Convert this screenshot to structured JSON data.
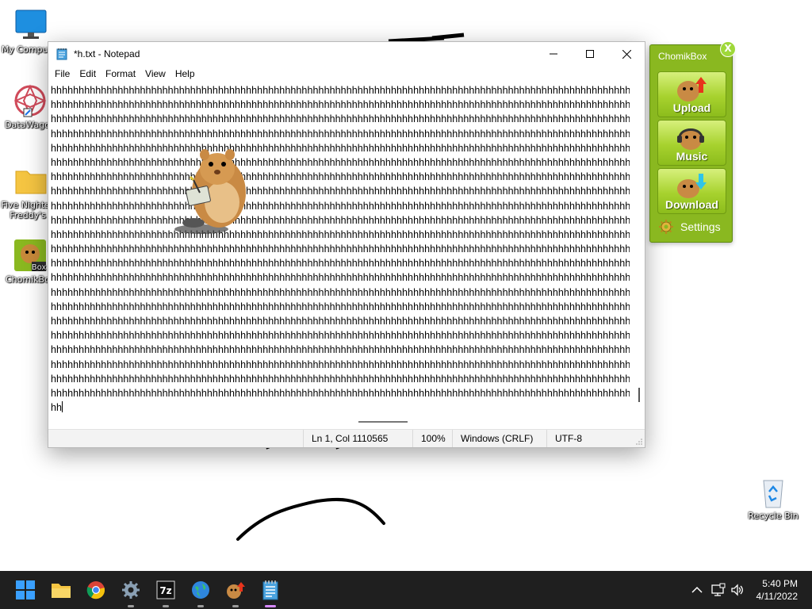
{
  "desktop": {
    "icons": [
      {
        "label": "My Computer",
        "icon": "monitor-icon"
      },
      {
        "label": "DataWagon",
        "icon": "datawagon-icon"
      },
      {
        "label": "Five Nights at",
        "label2": "Freddy's (",
        "icon": "folder-icon"
      },
      {
        "label": "ChomikBox",
        "icon": "chomikbox-icon"
      },
      {
        "label": "Recycle Bin",
        "icon": "recycle-bin-icon"
      }
    ]
  },
  "notepad": {
    "title": "*h.txt - Notepad",
    "menu": [
      "File",
      "Edit",
      "Format",
      "View",
      "Help"
    ],
    "line_text": "hhhhhhhhhhhhhhhhhhhhhhhhhhhhhhhhhhhhhhhhhhhhhhhhhhhhhhhhhhhhhhhhhhhhhhhhhhhhhhhhhhhhhhhhhhhhhhhhhhhhhhhhhhhhhhhhhhhhhhhhhhhhhhhhhhhhhhhhhhhhhhhhhhhhhhhhhhhhhh",
    "full_lines": 22,
    "last_line": "hh",
    "status": {
      "position": "Ln 1, Col 1110565",
      "zoom": "100%",
      "line_ending": "Windows (CRLF)",
      "encoding": "UTF-8"
    }
  },
  "chomikbox": {
    "title": "ChomikBox",
    "close": "X",
    "buttons": [
      {
        "label": "Upload",
        "icon": "upload-arrow-icon"
      },
      {
        "label": "Music",
        "icon": "headphones-icon"
      },
      {
        "label": "Download",
        "icon": "download-arrow-icon"
      }
    ],
    "settings_label": "Settings"
  },
  "taskbar": {
    "apps": [
      "start",
      "file-explorer",
      "chrome",
      "settings",
      "7zip",
      "network-globe",
      "chomikbox",
      "notepad"
    ],
    "active_app": "notepad",
    "time": "5:40 PM",
    "date": "4/11/2022"
  },
  "colors": {
    "taskbar_bg": "#1f1f1f",
    "chomikbox_green": "#8ab820",
    "active_indicator": "#d689ff"
  }
}
